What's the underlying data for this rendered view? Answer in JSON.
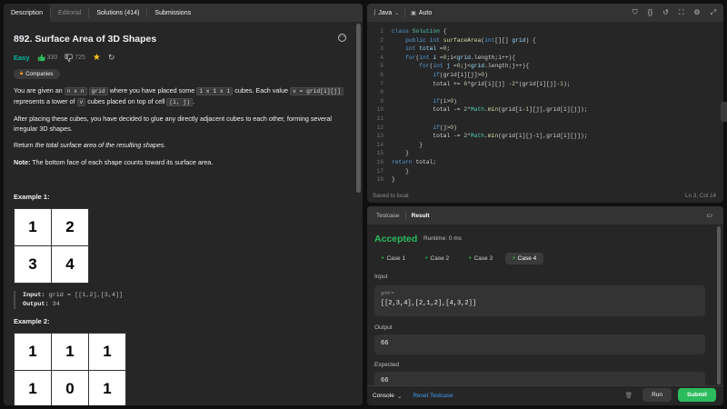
{
  "left": {
    "tabs": [
      "Description",
      "Editorial",
      "Solutions (414)",
      "Submissions"
    ],
    "title": "892. Surface Area of 3D Shapes",
    "difficulty": "Easy",
    "likes": "330",
    "dislikes": "725",
    "companies": "Companies",
    "desc": {
      "p1_a": "You are given an ",
      "p1_c1": "n x n",
      "p1_b": " ",
      "p1_c2": "grid",
      "p1_c": " where you have placed some ",
      "p1_c3": "1 x 1 x 1",
      "p1_d": " cubes. Each value ",
      "p1_c4": "v = grid[i][j]",
      "p1_e": " represents a tower of ",
      "p1_c5": "v",
      "p1_f": " cubes placed on top of cell ",
      "p1_c6": "(i, j)",
      "p1_g": ".",
      "p2": "After placing these cubes, you have decided to glue any directly adjacent cubes to each other, forming several irregular 3D shapes.",
      "p3_a": "Return ",
      "p3_b": "the total surface area of the resulting shapes",
      "p3_c": ".",
      "note_label": "Note:",
      "note": " The bottom face of each shape counts toward its surface area."
    },
    "example1": {
      "title": "Example 1:",
      "grid": [
        [
          "1",
          "2"
        ],
        [
          "3",
          "4"
        ]
      ],
      "input_label": "Input:",
      "input": " grid = [[1,2],[3,4]]",
      "output_label": "Output:",
      "output": " 34"
    },
    "example2": {
      "title": "Example 2:",
      "grid": [
        [
          "1",
          "1",
          "1"
        ],
        [
          "1",
          "0",
          "1"
        ]
      ]
    }
  },
  "editor": {
    "language": "Java",
    "mode": "Auto",
    "status_left": "Saved to local",
    "status_right": "Ln 3, Col 14"
  },
  "bottom": {
    "tabs": [
      "Testcase",
      "Result"
    ],
    "verdict": "Accepted",
    "runtime": "Runtime: 0 ms",
    "cases": [
      "Case 1",
      "Case 2",
      "Case 3",
      "Case 4"
    ],
    "input_label": "Input",
    "input_key": "grid =",
    "input_value": "[[2,3,4],[2,1,2],[4,3,2]]",
    "output_label": "Output",
    "output_value": "66",
    "expected_label": "Expected",
    "expected_value": "66",
    "console": "Console",
    "reset": "Reset Testcase",
    "run": "Run",
    "submit": "Submit"
  },
  "colors": {
    "accepted": "#2cbb5d",
    "easy": "#00b8a3",
    "panel": "#262626"
  }
}
